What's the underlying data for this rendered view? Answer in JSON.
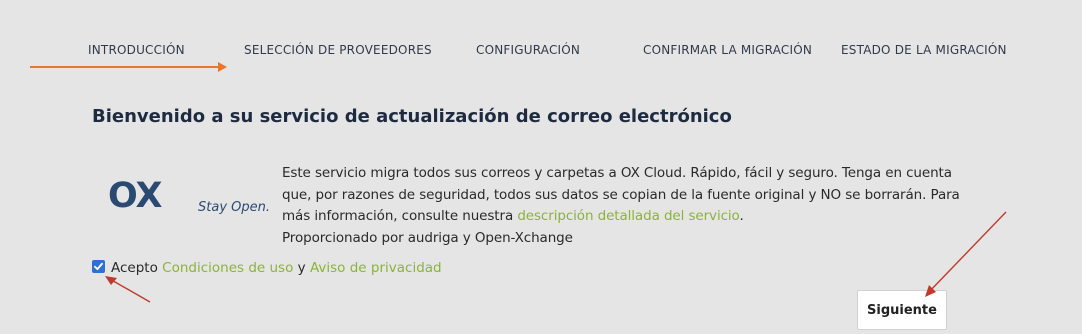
{
  "wizard": {
    "steps": [
      {
        "label": "INTRODUCCIÓN"
      },
      {
        "label": "SELECCIÓN DE PROVEEDORES"
      },
      {
        "label": "CONFIGURACIÓN"
      },
      {
        "label": "CONFIRMAR LA MIGRACIÓN"
      },
      {
        "label": "ESTADO DE LA MIGRACIÓN"
      }
    ],
    "active_step": "INTRODUCCIÓN"
  },
  "main": {
    "title": "Bienvenido a su servicio de actualización de correo electrónico",
    "logo": {
      "text": "OX",
      "tagline": "Stay Open."
    },
    "intro": {
      "text_before_link": "Este servicio migra todos sus correos y carpetas a OX Cloud. Rápido, fácil y seguro. Tenga en cuenta que, por razones de seguridad, todos sus datos se copian de la fuente original y NO se borrarán. Para más información, consulte nuestra ",
      "link_label": "descripción detallada del servicio",
      "text_after_link": ".",
      "provided_by": "Proporcionado por audriga y Open-Xchange"
    },
    "accept": {
      "checked": true,
      "prefix": "Acepto",
      "terms_link": "Condiciones de uso",
      "conjunction": "y",
      "privacy_link": "Aviso de privacidad"
    },
    "next_label": "Siguiente"
  },
  "colors": {
    "background": "#e5e5e5",
    "accent_orange": "#e8772e",
    "link_green": "#8bb33a",
    "title_navy": "#1d2a3f",
    "logo_blue": "#2b4a72",
    "annotation_red": "#c0392b",
    "checkbox_blue": "#2f6fd6"
  }
}
